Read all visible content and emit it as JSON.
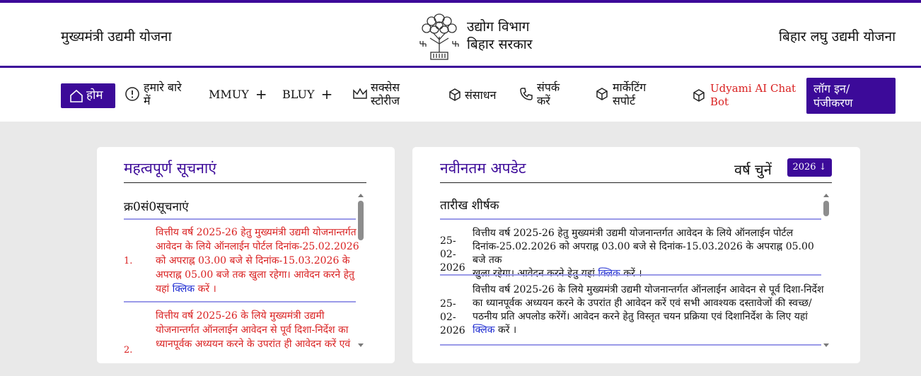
{
  "header": {
    "left_title": "मुख्यमंत्री उद्यमी योजना",
    "dept_line1": "उद्योग विभाग",
    "dept_line2": "बिहार सरकार",
    "right_title": "बिहार लघु उद्यमी योजना"
  },
  "nav": {
    "home": "होम",
    "about_l1": "हमारे बारे",
    "about_l2": "में",
    "mmuy": "MMUY",
    "bluy": "BLUY",
    "plus": "+",
    "success_l1": "सक्सेस",
    "success_l2": "स्टोरीज",
    "resources": "संसाधन",
    "contact_l1": "संपर्क",
    "contact_l2": "करें",
    "marketing_l1": "मार्केटिंग",
    "marketing_l2": "सपोर्ट",
    "chatbot_l1": "Udyami AI Chat",
    "chatbot_l2": "Bot",
    "login_l1": "लॉग इन/",
    "login_l2": "पंजीकरण"
  },
  "notices": {
    "title": "महत्वपूर्ण सूचनाएं",
    "col_header": "क्र0सं0सूचनाएं",
    "items": [
      {
        "num": "1.",
        "lines": [
          "वित्तीय वर्ष 2025-26 हेतु मुख्यमंत्री उद्यमी योजनान्तर्गत",
          "आवेदन के लिये ऑनलाईन पोर्टल दिनांक-25.02.2026",
          "को अपराह्न 03.00 बजे से दिनांक-15.03.2026 के",
          "अपराह्न 05.00 बजे तक खुला रहेगा। आवेदन करने हेतु"
        ],
        "last_pre": "यहां ",
        "link": "क्लिक",
        "last_post": " करें ।"
      },
      {
        "num": "2.",
        "lines": [
          "वित्तीय वर्ष 2025-26 के लिये मुख्यमंत्री उद्यमी",
          "योजनान्तर्गत ऑनलाईन आवेदन से पूर्व दिशा-निर्देश का",
          "ध्यानपूर्वक अध्ययन करने के उपरांत ही आवेदन करें एवं"
        ]
      }
    ]
  },
  "updates": {
    "title": "नवीनतम अपडेट",
    "year_label": "वर्ष चुनें",
    "year_value": "2026 ↓",
    "col_header": "तारीख शीर्षक",
    "items": [
      {
        "date_l1": "25-02-",
        "date_l2": "2026",
        "lines": [
          "वित्तीय वर्ष 2025-26 हेतु मुख्यमंत्री उद्यमी योजनान्तर्गत आवेदन के लिये ऑनलाईन पोर्टल",
          "दिनांक-25.02.2026 को अपराह्न 03.00 बजे से दिनांक-15.03.2026 के अपराह्न 05.00 बजे तक"
        ],
        "last_pre": "खुला रहेगा। आवेदन करने हेतु यहां ",
        "link": "क्लिक",
        "last_post": " करें ।"
      },
      {
        "date_l1": "25-02-",
        "date_l2": "2026",
        "lines": [
          "वित्तीय वर्ष 2025-26 के लिये मुख्यमंत्री उद्यमी योजनान्तर्गत ऑनलाईन आवेदन से पूर्व दिशा-निर्देश",
          "का ध्यानपूर्वक अध्ययन करने के उपरांत ही आवेदन करें एवं सभी आवश्यक दस्तावेजों की स्वच्छ/",
          "पठनीय प्रति अपलोड करेंगें। आवेदन करने हेतु विस्तृत चयन प्रक्रिया एवं दिशानिर्देश के लिए यहां"
        ],
        "last_pre": "",
        "link": "क्लिक",
        "last_post": " करें ।"
      }
    ]
  },
  "colors": {
    "brand": "#3c0a99",
    "notice_red": "#d92020",
    "link_blue": "#1a28d0"
  }
}
